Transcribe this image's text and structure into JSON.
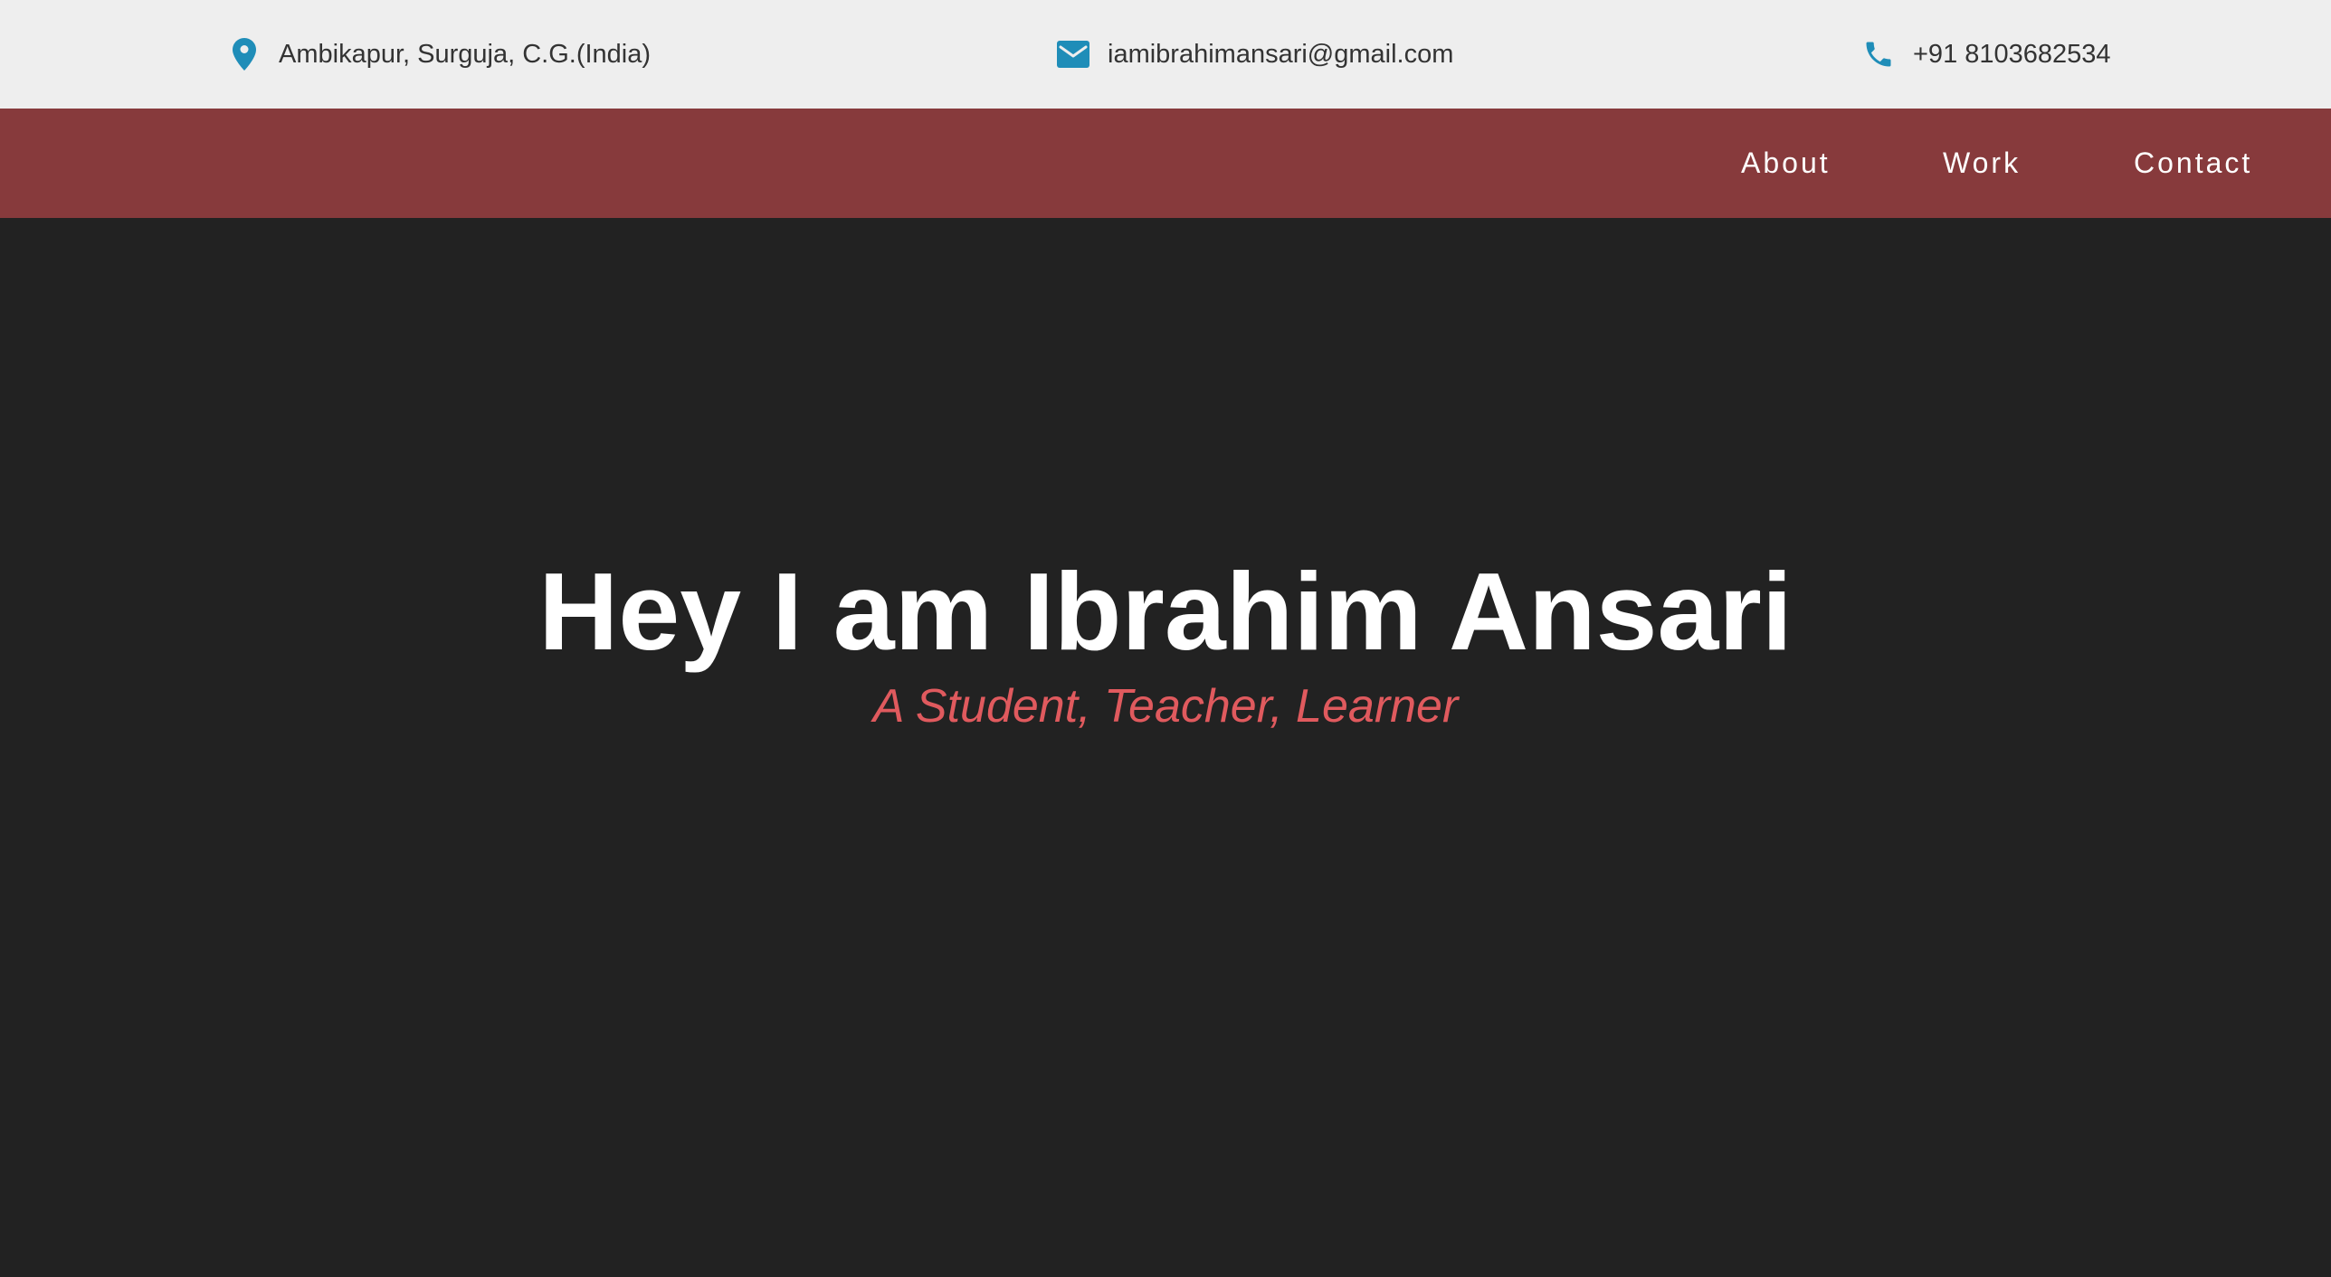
{
  "contact_bar": {
    "location": {
      "icon": "map-pin-icon",
      "text": "Ambikapur, Surguja, C.G.(India)"
    },
    "email": {
      "icon": "envelope-icon",
      "text": "iamibrahimansari@gmail.com"
    },
    "phone": {
      "icon": "phone-icon",
      "text": "+91 8103682534"
    },
    "icon_color": "#1f8db8",
    "background": "#eeeeee"
  },
  "nav": {
    "items": [
      {
        "label": "About"
      },
      {
        "label": "Work"
      },
      {
        "label": "Contact"
      }
    ],
    "background": "#873a3c"
  },
  "hero": {
    "title": "Hey I am Ibrahim Ansari",
    "subtitle": "A Student, Teacher, Learner",
    "subtitle_color": "#e05a5e",
    "background": "#222222"
  }
}
